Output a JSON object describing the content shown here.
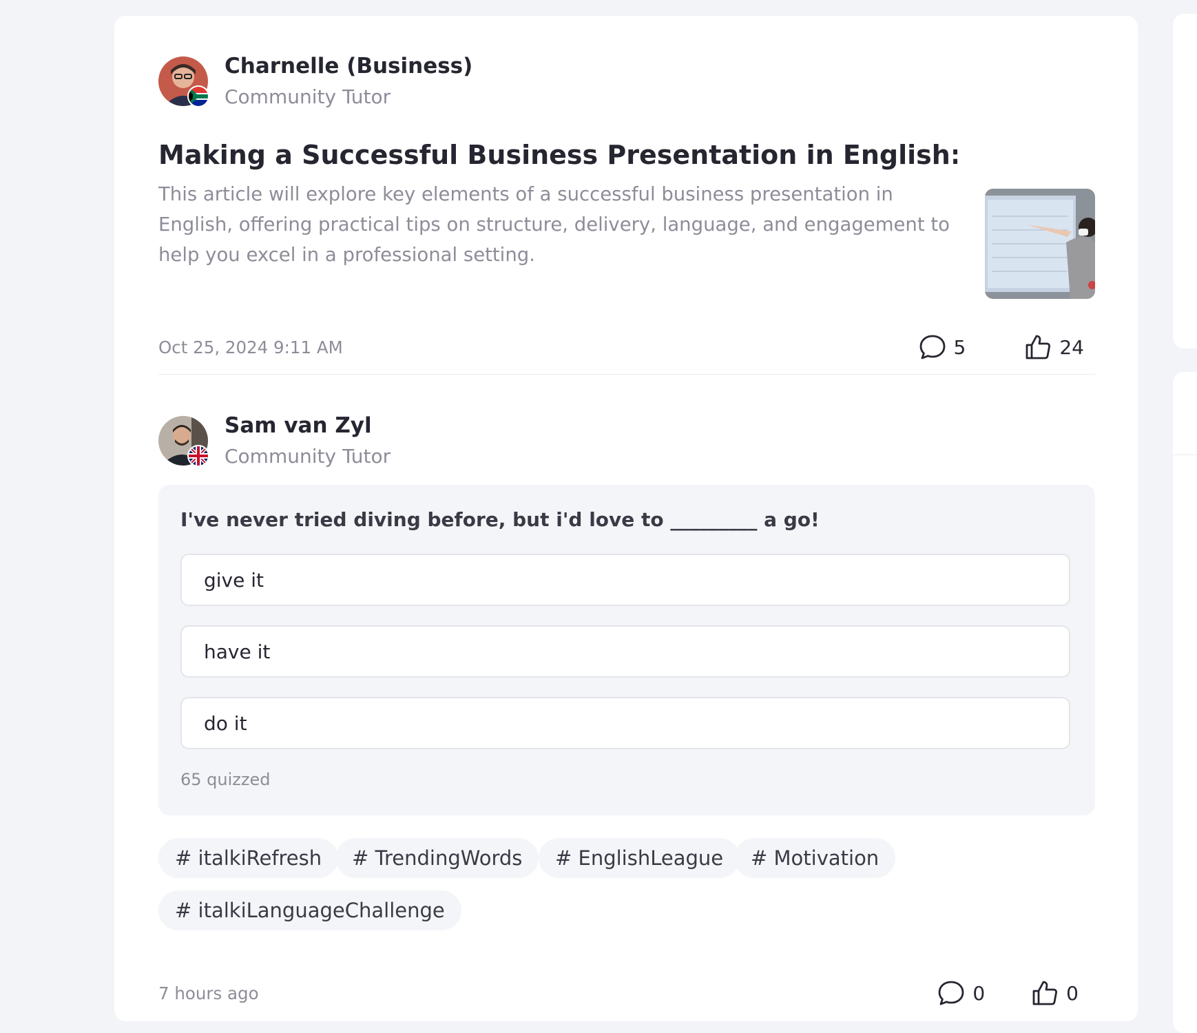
{
  "posts": [
    {
      "author": {
        "name": "Charnelle (Business)",
        "role": "Community Tutor",
        "flag": "south-africa"
      },
      "title": "Making a Successful Business Presentation in English: Ti...",
      "summary": "This article will explore key elements of a successful business presentation in English, offering practical tips on structure, delivery, language, and engagement to help you excel in a professional setting.",
      "timestamp": "Oct 25, 2024 9:11 AM",
      "comments": "5",
      "likes": "24"
    },
    {
      "author": {
        "name": "Sam van Zyl",
        "role": "Community Tutor",
        "flag": "united-kingdom"
      },
      "quiz": {
        "question": "I've never tried diving before, but i'd love to _________ a go!",
        "options": [
          "give it",
          "have it",
          "do it"
        ],
        "count": "65 quizzed"
      },
      "tags": [
        "# italkiRefresh",
        "# TrendingWords",
        "# EnglishLeague",
        "# Motivation",
        "# italkiLanguageChallenge"
      ],
      "timestamp": "7 hours ago",
      "comments": "0",
      "likes": "0"
    }
  ],
  "icons": {
    "comment": "comment-bubble-icon",
    "like": "thumbs-up-icon"
  },
  "colors": {
    "text": "#262631",
    "muted": "#8d8d99",
    "background": "#f3f4f7",
    "surface": "#ffffff",
    "chip": "#f4f5f8"
  }
}
